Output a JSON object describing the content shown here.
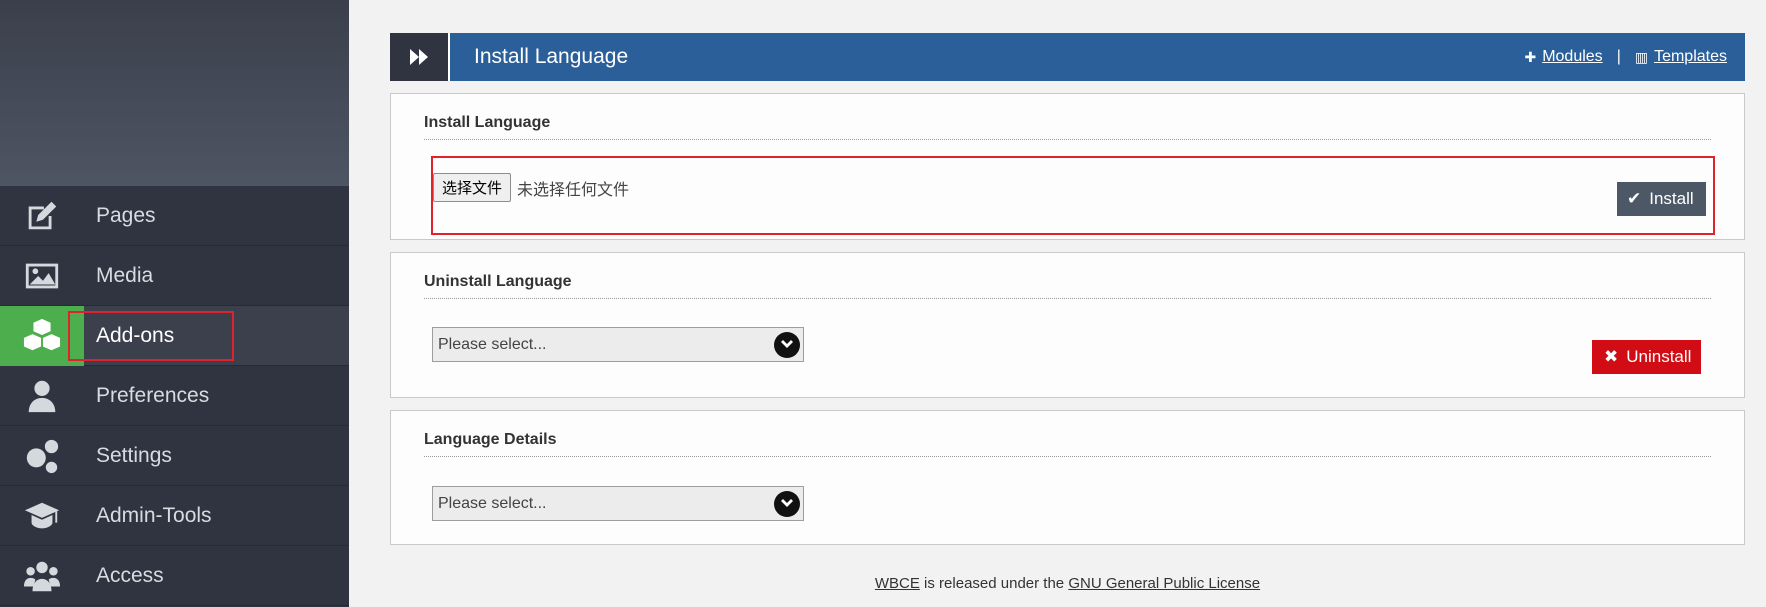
{
  "sidebar": {
    "items": [
      {
        "label": "Pages",
        "icon": "edit-icon"
      },
      {
        "label": "Media",
        "icon": "image-icon"
      },
      {
        "label": "Add-ons",
        "icon": "cubes-icon",
        "active": true
      },
      {
        "label": "Preferences",
        "icon": "user-icon"
      },
      {
        "label": "Settings",
        "icon": "gears-icon"
      },
      {
        "label": "Admin-Tools",
        "icon": "graduation-cap-icon"
      },
      {
        "label": "Access",
        "icon": "users-icon"
      }
    ]
  },
  "header": {
    "title": "Install Language",
    "modules_link": "Modules",
    "templates_link": "Templates",
    "separator": "|"
  },
  "install_section": {
    "heading": "Install Language",
    "file_button": "选择文件",
    "file_status": "未选择任何文件",
    "button": "Install"
  },
  "uninstall_section": {
    "heading": "Uninstall Language",
    "select_value": "Please select...",
    "button": "Uninstall"
  },
  "details_section": {
    "heading": "Language Details",
    "select_value": "Please select..."
  },
  "footer": {
    "brand": "WBCE",
    "text": " is released under the ",
    "license": "GNU General Public License"
  },
  "colors": {
    "header_blue": "#2b5f99",
    "active_green": "#4cae4c",
    "uninstall_red": "#d10c14",
    "highlight_red": "#e0222c"
  }
}
